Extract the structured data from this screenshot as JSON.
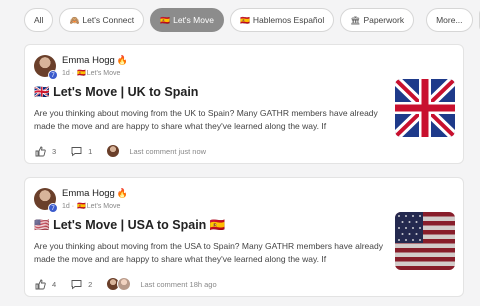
{
  "filters": [
    {
      "label": "All",
      "emoji": "",
      "active": false
    },
    {
      "label": "Let's Connect",
      "emoji": "🙈",
      "active": false
    },
    {
      "label": "Let's Move",
      "emoji": "🇪🇸",
      "active": true
    },
    {
      "label": "Hablemos Español",
      "emoji": "🇪🇸",
      "active": false
    },
    {
      "label": "Paperwork",
      "emoji": "🏛",
      "active": false
    }
  ],
  "more_label": "More...",
  "posts": [
    {
      "author": "Emma Hogg",
      "author_emoji": "🔥",
      "badge": "7",
      "time": "1d",
      "category_flag": "🇪🇸",
      "category": "Let's Move",
      "title_flag": "🇬🇧",
      "title": "Let's Move | UK to Spain",
      "title_suffix": "",
      "excerpt": "Are you thinking about moving from the UK to Spain? Many GATHR members have already made the move and are happy to share what they've learned along the way. If",
      "likes": "3",
      "comments": "1",
      "last_comment": "Last comment just now",
      "thumb_icon": "uk-flag-image"
    },
    {
      "author": "Emma Hogg",
      "author_emoji": "🔥",
      "badge": "7",
      "time": "1d",
      "category_flag": "🇪🇸",
      "category": "Let's Move",
      "title_flag": "🇺🇸",
      "title": "Let's Move | USA to Spain",
      "title_suffix": "🇪🇸",
      "excerpt": "Are you thinking about moving from the USA to Spain? Many GATHR members have already made the move and are happy to share what they've learned along the way. If",
      "likes": "4",
      "comments": "2",
      "last_comment": "Last comment 18h ago",
      "thumb_icon": "usa-flag-image"
    }
  ]
}
